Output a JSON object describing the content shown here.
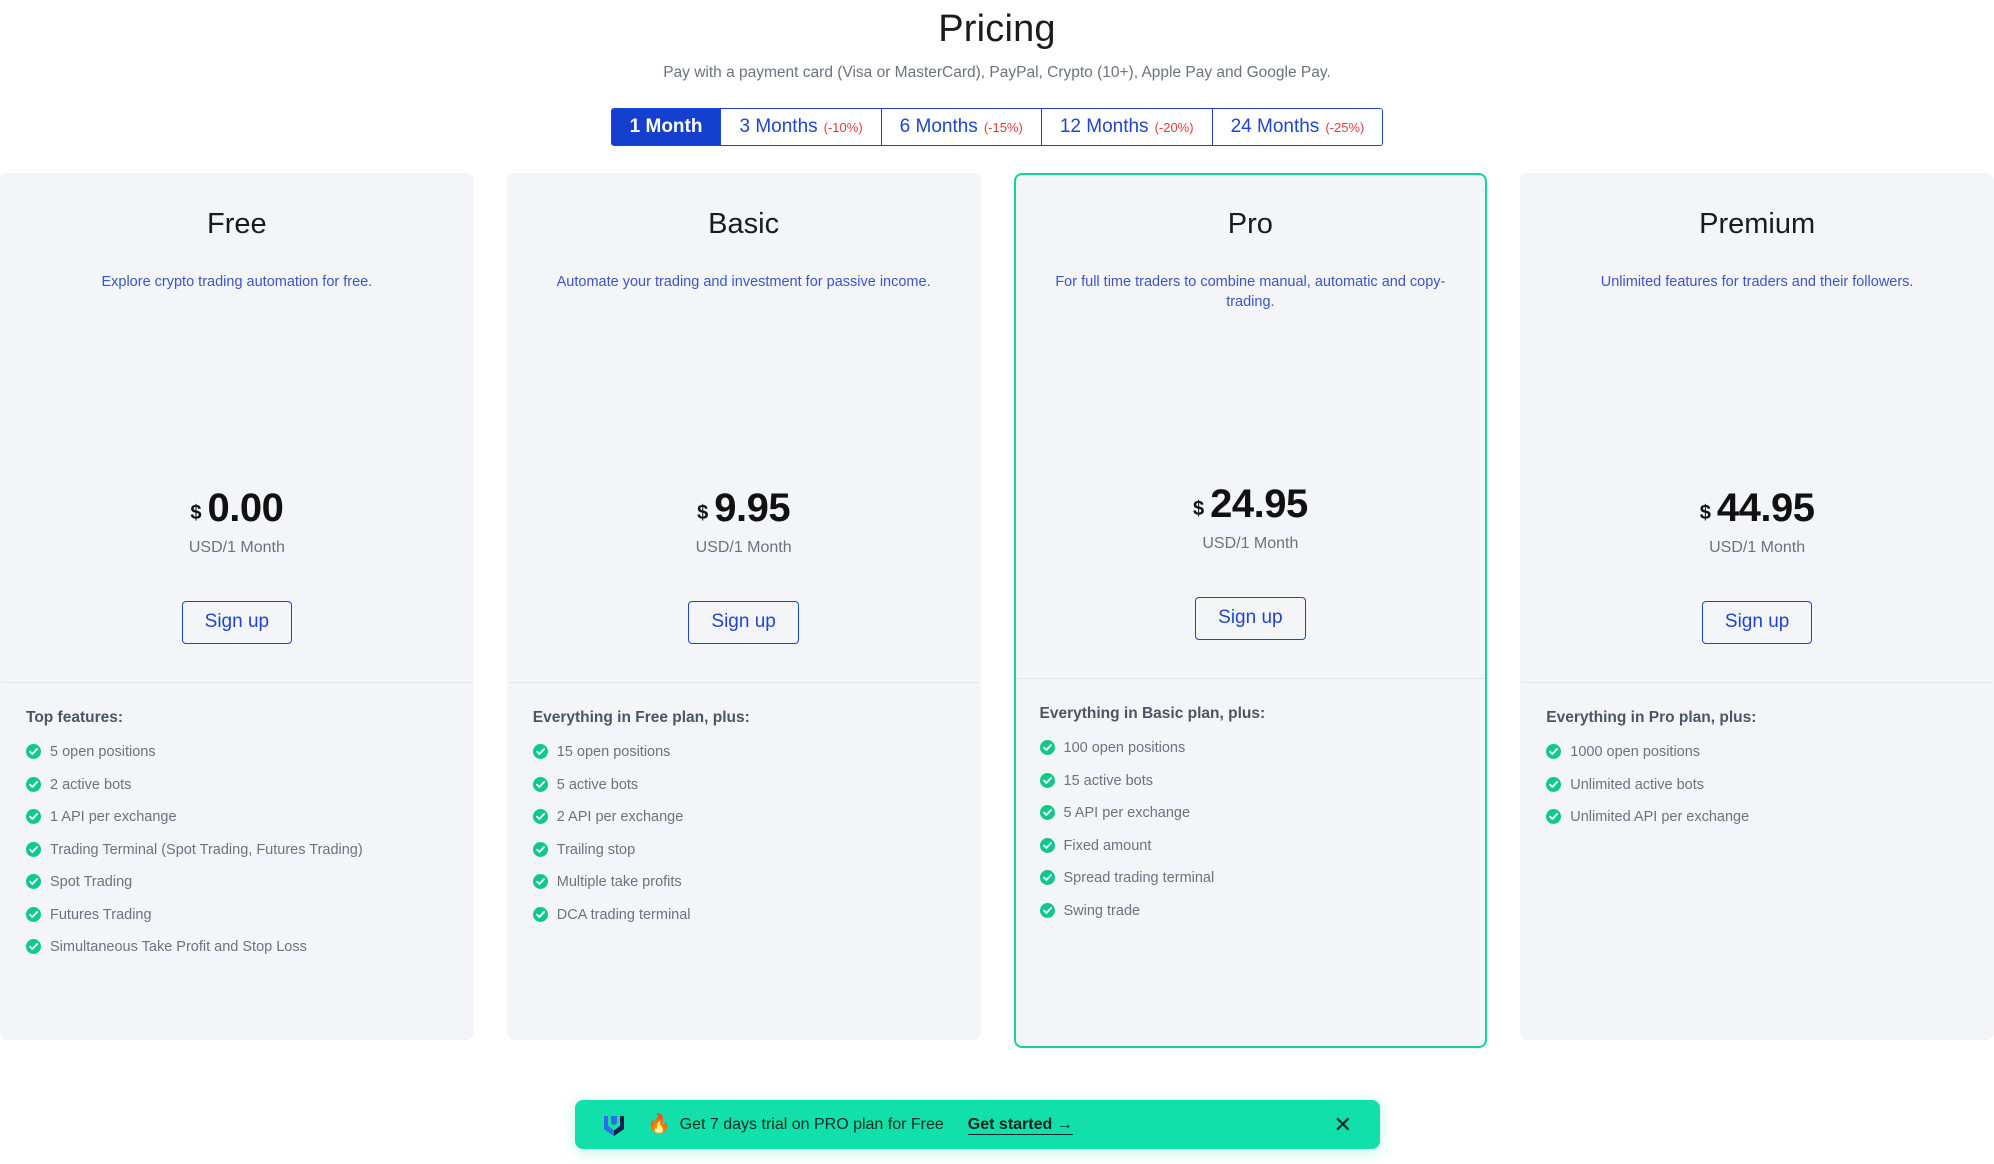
{
  "header": {
    "title": "Pricing",
    "subtitle": "Pay with a payment card (Visa or MasterCard), PayPal, Crypto (10+), Apple Pay and Google Pay."
  },
  "period_toggle": {
    "tabs": [
      {
        "label": "1 Month",
        "discount": "",
        "active": true
      },
      {
        "label": "3 Months",
        "discount": "(-10%)",
        "active": false
      },
      {
        "label": "6 Months",
        "discount": "(-15%)",
        "active": false
      },
      {
        "label": "12 Months",
        "discount": "(-20%)",
        "active": false
      },
      {
        "label": "24 Months",
        "discount": "(-25%)",
        "active": false
      }
    ]
  },
  "colors": {
    "accent_blue": "#1440cd",
    "link_blue": "#1f45cf",
    "discount_red": "#e23b3b",
    "featured_green": "#0fd698",
    "banner_green": "#12e0ab",
    "check_green": "#0fc98a",
    "card_bg": "#f4f5f9"
  },
  "plans": [
    {
      "name": "Free",
      "tagline": "Explore crypto trading automation for free.",
      "currency": "$",
      "amount": "0.00",
      "period": "USD/1 Month",
      "cta": "Sign up",
      "features_title": "Top features:",
      "features": [
        "5 open positions",
        " 2 active bots",
        "1 API per exchange",
        "Trading Terminal (Spot Trading, Futures Trading)",
        "Spot Trading",
        "Futures Trading",
        "Simultaneous Take Profit and Stop Loss"
      ]
    },
    {
      "name": "Basic",
      "tagline": "Automate your trading and investment for passive income.",
      "currency": "$",
      "amount": "9.95",
      "period": "USD/1 Month",
      "cta": "Sign up",
      "features_title": "Everything in Free plan, plus:",
      "features": [
        "15 open positions",
        " 5 active bots",
        "2 API per exchange",
        "Trailing stop",
        "Multiple take profits",
        "DCA trading terminal"
      ]
    },
    {
      "name": "Pro",
      "tagline": "For full time traders to combine manual, automatic and copy-trading.",
      "currency": "$",
      "amount": "24.95",
      "period": "USD/1 Month",
      "cta": "Sign up",
      "features_title": "Everything in Basic plan, plus:",
      "features": [
        "100 open positions",
        " 15 active bots",
        "5 API per exchange",
        "Fixed amount",
        "Spread trading terminal",
        "Swing trade"
      ]
    },
    {
      "name": "Premium",
      "tagline": "Unlimited features for traders and their followers.",
      "currency": "$",
      "amount": "44.95",
      "period": "USD/1 Month",
      "cta": "Sign up",
      "features_title": "Everything in Pro plan, plus:",
      "features": [
        "1000 open positions",
        "Unlimited active bots",
        "Unlimited API per exchange"
      ]
    }
  ],
  "promo_banner": {
    "logo_icon": "app-logo-icon",
    "fire_icon": "🔥",
    "text": "Get 7 days trial on PRO plan for Free",
    "cta": "Get started →",
    "close_icon": "✕"
  }
}
